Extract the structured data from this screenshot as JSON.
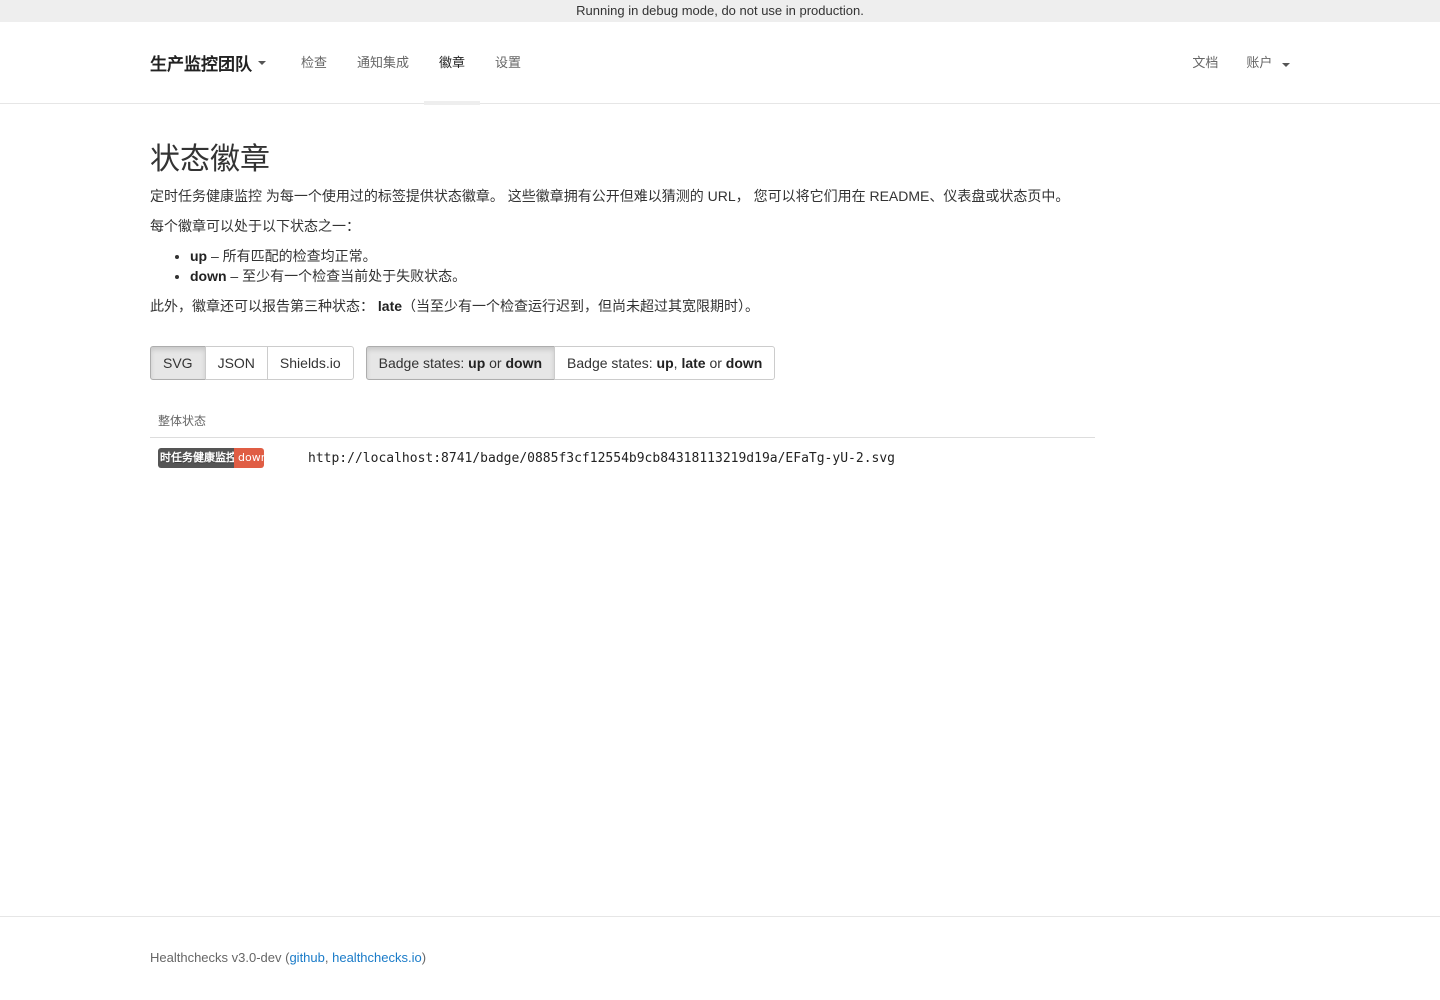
{
  "debug_banner": "Running in debug mode, do not use in production.",
  "nav": {
    "brand": "生产监控团队",
    "links": [
      "检查",
      "通知集成",
      "徽章",
      "设置"
    ],
    "active": "徽章",
    "right_links": [
      "文档",
      "账户"
    ]
  },
  "page": {
    "title": "状态徽章",
    "intro": "定时任务健康监控 为每一个使用过的标签提供状态徽章。 这些徽章拥有公开但难以猜测的 URL， 您可以将它们用在 README、仪表盘或状态页中。",
    "states_intro": "每个徽章可以处于以下状态之一：",
    "states": [
      {
        "name": "up",
        "desc": " – 所有匹配的检查均正常。"
      },
      {
        "name": "down",
        "desc": " – 至少有一个检查当前处于失败状态。"
      }
    ],
    "late_prefix": "此外，徽章还可以报告第三种状态：",
    "late_name": "late",
    "late_desc": "（当至少有一个检查运行迟到，但尚未超过其宽限期时）。"
  },
  "format_buttons": [
    {
      "label": "SVG",
      "active": true
    },
    {
      "label": "JSON",
      "active": false
    },
    {
      "label": "Shields.io",
      "active": false
    }
  ],
  "state_buttons": {
    "two": {
      "prefix": "Badge states: ",
      "up": "up",
      "or": " or ",
      "down": "down",
      "active": true
    },
    "three": {
      "prefix": "Badge states: ",
      "up": "up",
      "comma": ", ",
      "late": "late",
      "or": " or ",
      "down": "down",
      "active": false
    }
  },
  "badge_table": {
    "header": "整体状态",
    "rows": [
      {
        "badge_label": "时任务健康监控",
        "badge_status": "down",
        "status_color": "#e05d44",
        "url": "http://localhost:8741/badge/0885f3cf12554b9cb84318113219d19a/EFaTg-yU-2.svg"
      }
    ]
  },
  "footer": {
    "prefix": "Healthchecks v3.0-dev (",
    "link1": "github",
    "sep": ", ",
    "link2": "healthchecks.io",
    "suffix": ")"
  }
}
